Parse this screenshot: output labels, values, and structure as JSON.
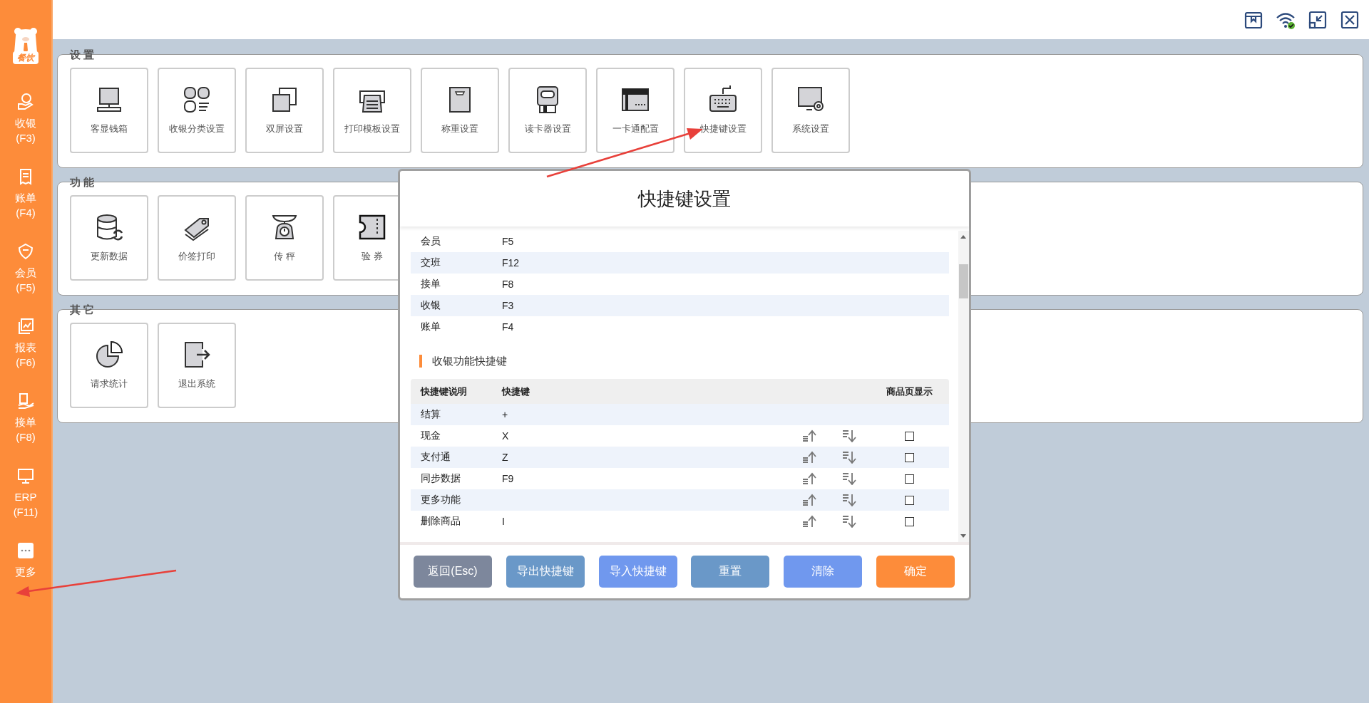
{
  "sidebar": {
    "logo_badge": "餐饮",
    "items": [
      {
        "label": "收银",
        "shortcut": "(F3)"
      },
      {
        "label": "账单",
        "shortcut": "(F4)"
      },
      {
        "label": "会员",
        "shortcut": "(F5)"
      },
      {
        "label": "报表",
        "shortcut": "(F6)"
      },
      {
        "label": "接单",
        "shortcut": "(F8)"
      },
      {
        "label": "ERP",
        "shortcut": "(F11)"
      },
      {
        "label": "更多"
      }
    ]
  },
  "sections": [
    {
      "title": "设 置",
      "cards": [
        {
          "label": "客显钱箱"
        },
        {
          "label": "收银分类设置"
        },
        {
          "label": "双屏设置"
        },
        {
          "label": "打印模板设置"
        },
        {
          "label": "称重设置"
        },
        {
          "label": "读卡器设置"
        },
        {
          "label": "一卡通配置"
        },
        {
          "label": "快捷键设置"
        },
        {
          "label": "系统设置"
        }
      ]
    },
    {
      "title": "功 能",
      "cards": [
        {
          "label": "更新数据"
        },
        {
          "label": "价签打印"
        },
        {
          "label": "传 秤"
        },
        {
          "label": "验 券"
        }
      ]
    },
    {
      "title": "其 它",
      "cards": [
        {
          "label": "请求统计"
        },
        {
          "label": "退出系统"
        }
      ]
    }
  ],
  "dialog": {
    "title": "快捷键设置",
    "general_rows": [
      {
        "name": "会员",
        "key": "F5"
      },
      {
        "name": "交班",
        "key": "F12"
      },
      {
        "name": "接单",
        "key": "F8"
      },
      {
        "name": "收银",
        "key": "F3"
      },
      {
        "name": "账单",
        "key": "F4"
      }
    ],
    "section_title": "收银功能快捷键",
    "columns": [
      "快捷键说明",
      "快捷键",
      "商品页显示"
    ],
    "rows": [
      {
        "name": "结算",
        "key": "+",
        "kind": "fixed"
      },
      {
        "name": "现金",
        "key": "X",
        "kind": "sortable",
        "checked": false
      },
      {
        "name": "支付通",
        "key": "Z",
        "kind": "sortable",
        "checked": false
      },
      {
        "name": "同步数据",
        "key": "F9",
        "kind": "sortable",
        "checked": false
      },
      {
        "name": "更多功能",
        "kind": "sortable",
        "checked": false
      },
      {
        "name": "删除商品",
        "key": "I",
        "kind": "sortable",
        "checked": false
      }
    ],
    "buttons": [
      {
        "label": "返回(Esc)",
        "color": "#7d879c"
      },
      {
        "label": "导出快捷键",
        "color": "#6a98c8"
      },
      {
        "label": "导入快捷键",
        "color": "#7098ee"
      },
      {
        "label": "重置",
        "color": "#6a98c8"
      },
      {
        "label": "清除",
        "color": "#7098ee"
      },
      {
        "label": "确定",
        "color": "#fd8c3a"
      }
    ]
  }
}
